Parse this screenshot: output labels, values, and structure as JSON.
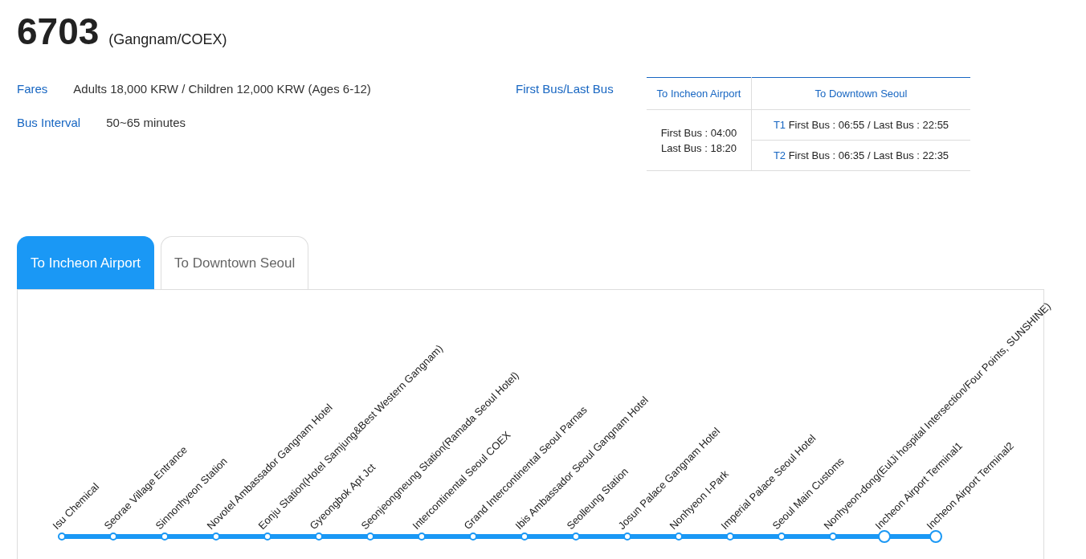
{
  "route": {
    "number": "6703",
    "name": "(Gangnam/COEX)"
  },
  "info": [
    {
      "label": "Fares",
      "value": "Adults 18,000 KRW / Children 12,000 KRW (Ages 6-12)"
    },
    {
      "label": "Bus Interval",
      "value": "50~65 minutes"
    }
  ],
  "schedule": {
    "label": "First Bus/Last Bus",
    "columns": [
      "To Incheon Airport",
      "To Downtown Seoul"
    ],
    "airport_times": [
      "First Bus : 04:00",
      "Last Bus : 18:20"
    ],
    "downtown_rows": [
      {
        "terminal": "T1",
        "times": "First Bus : 06:55 / Last Bus : 22:55"
      },
      {
        "terminal": "T2",
        "times": "First Bus : 06:35 / Last Bus : 22:35"
      }
    ]
  },
  "tabs": [
    {
      "label": "To Incheon Airport",
      "selected": true
    },
    {
      "label": "To Downtown Seoul",
      "selected": false
    }
  ],
  "stops": [
    {
      "name": "Isu Chemical",
      "kind": "stop"
    },
    {
      "name": "Seorae Village Entrance",
      "kind": "stop"
    },
    {
      "name": "Sinnonhyeon Station",
      "kind": "stop"
    },
    {
      "name": "Novotel Ambassador Gangnam Hotel",
      "kind": "stop"
    },
    {
      "name": "Eonju Station(Hotel Samjung&Best Western Gangnam)",
      "kind": "stop"
    },
    {
      "name": "Gyeongbok Apt Jct",
      "kind": "stop"
    },
    {
      "name": "Seonjeongneung Station(Ramada Seoul Hotel)",
      "kind": "stop"
    },
    {
      "name": "Intercontinental Seoul COEX",
      "kind": "stop"
    },
    {
      "name": "Grand Intercontinental Seoul Parnas",
      "kind": "stop"
    },
    {
      "name": "Ibis Ambassador Seoul Gangnam Hotel",
      "kind": "stop"
    },
    {
      "name": "Seolleung Station",
      "kind": "stop"
    },
    {
      "name": "Josun Palace Gangnam Hotel",
      "kind": "stop"
    },
    {
      "name": "Nonhyeon I-Park",
      "kind": "stop"
    },
    {
      "name": "Imperial Palace Seoul Hotel",
      "kind": "stop"
    },
    {
      "name": "Seoul Main Customs",
      "kind": "stop"
    },
    {
      "name": "Nonhyeon-dong(EulJi hospital Intersection/Four Points, SUNSHINE)",
      "kind": "stop"
    },
    {
      "name": "Incheon Airport Terminal1",
      "kind": "terminal"
    },
    {
      "name": "Incheon Airport Terminal2",
      "kind": "terminal"
    }
  ]
}
